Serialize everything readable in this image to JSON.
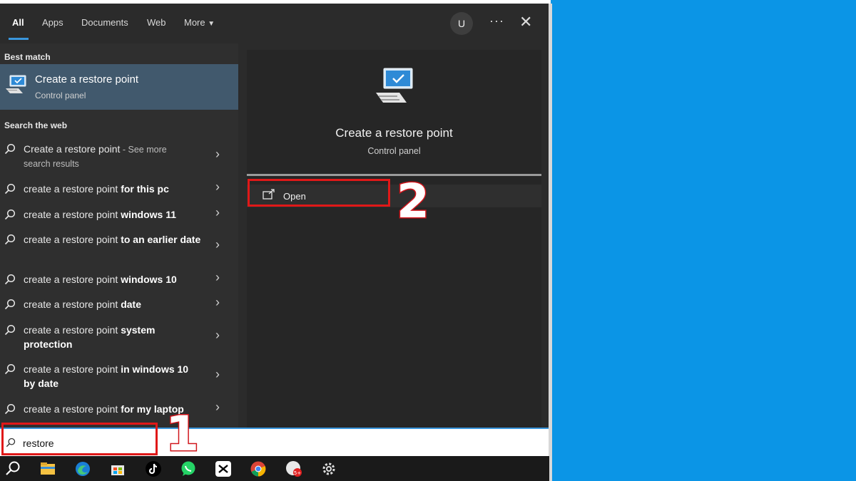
{
  "tabs": [
    {
      "label": "All",
      "active": true
    },
    {
      "label": "Apps",
      "active": false
    },
    {
      "label": "Documents",
      "active": false
    },
    {
      "label": "Web",
      "active": false
    },
    {
      "label": "More",
      "active": false
    }
  ],
  "header": {
    "avatar_letter": "U",
    "more_dots": "···",
    "close": "✕"
  },
  "best_match": {
    "section_title": "Best match",
    "title": "Create a restore point",
    "subtitle": "Control panel",
    "icon": "monitor-checkmark-icon"
  },
  "web": {
    "section_title": "Search the web",
    "items": [
      {
        "prefix": "Create a restore point",
        "suffix": "",
        "see_more": " - See more",
        "see_more_2": "search results"
      },
      {
        "prefix": "create a restore point ",
        "suffix": "for this pc"
      },
      {
        "prefix": "create a restore point ",
        "suffix": "windows 11"
      },
      {
        "prefix": "create a restore point ",
        "suffix": "to an earlier date"
      },
      {
        "prefix": "create a restore point ",
        "suffix": "windows 10"
      },
      {
        "prefix": "create a restore point ",
        "suffix": "date"
      },
      {
        "prefix": "create a restore point ",
        "suffix": "system protection"
      },
      {
        "prefix": "create a restore point ",
        "suffix": "in windows 10 by date"
      },
      {
        "prefix": "create a restore point ",
        "suffix": "for my laptop"
      }
    ]
  },
  "detail": {
    "title": "Create a restore point",
    "subtitle": "Control panel",
    "open_label": "Open"
  },
  "search": {
    "value": "restore"
  },
  "annotations": {
    "step1": "1",
    "step2": "2"
  },
  "taskbar": {
    "icons": [
      "search-icon",
      "file-explorer-icon",
      "edge-icon",
      "store-icon",
      "tiktok-icon",
      "whatsapp-icon",
      "capcut-icon",
      "chrome-icon",
      "zalo-icon",
      "settings-icon"
    ]
  },
  "colors": {
    "accent": "#3a96dd",
    "highlight_red": "#e01818",
    "desktop": "#0b95e6",
    "selected_row": "#41596d"
  }
}
